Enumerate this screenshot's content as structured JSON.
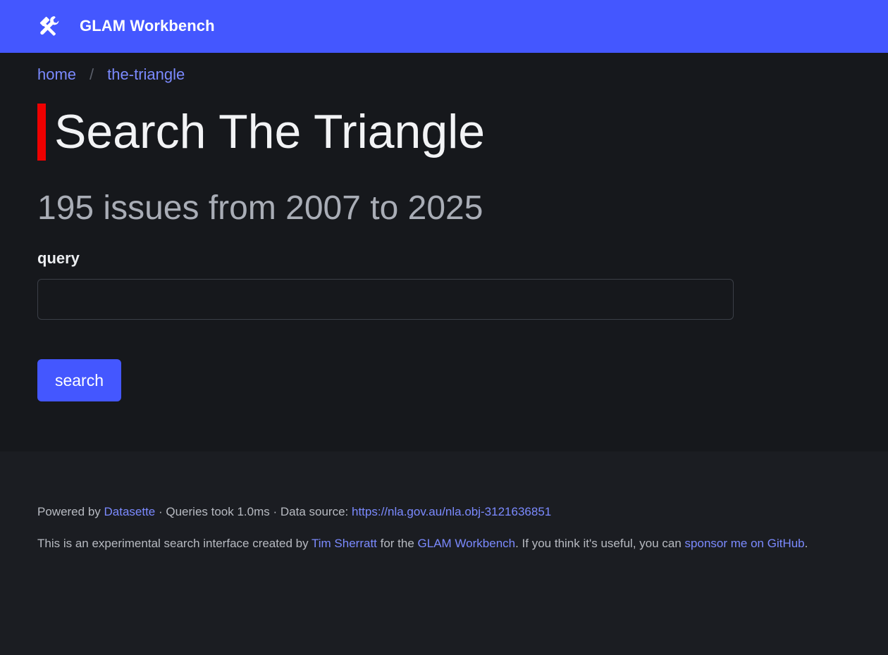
{
  "header": {
    "brand": "GLAM Workbench",
    "icon": "tools-icon"
  },
  "breadcrumb": {
    "home": "home",
    "separator": "/",
    "current": "the-triangle"
  },
  "page": {
    "title": "Search The Triangle",
    "subtitle": "195 issues from 2007 to 2025",
    "accent_color": "#ee0000"
  },
  "form": {
    "query_label": "query",
    "query_value": "",
    "search_button": "search"
  },
  "footer": {
    "powered_prefix": "Powered by ",
    "datasette_link": "Datasette",
    "queries_text": " · Queries took 1.0ms · Data source: ",
    "source_link": "https://nla.gov.au/nla.obj-3121636851",
    "line2_prefix": "This is an experimental search interface created by ",
    "author_link": "Tim Sherratt",
    "line2_mid": " for the ",
    "workbench_link": "GLAM Workbench",
    "line2_mid2": ". If you think it's useful, you can ",
    "sponsor_link": "sponsor me on GitHub",
    "line2_end": "."
  },
  "colors": {
    "header_bg": "#4457ff",
    "link": "#7b8aff",
    "button_bg": "#4457ff"
  }
}
